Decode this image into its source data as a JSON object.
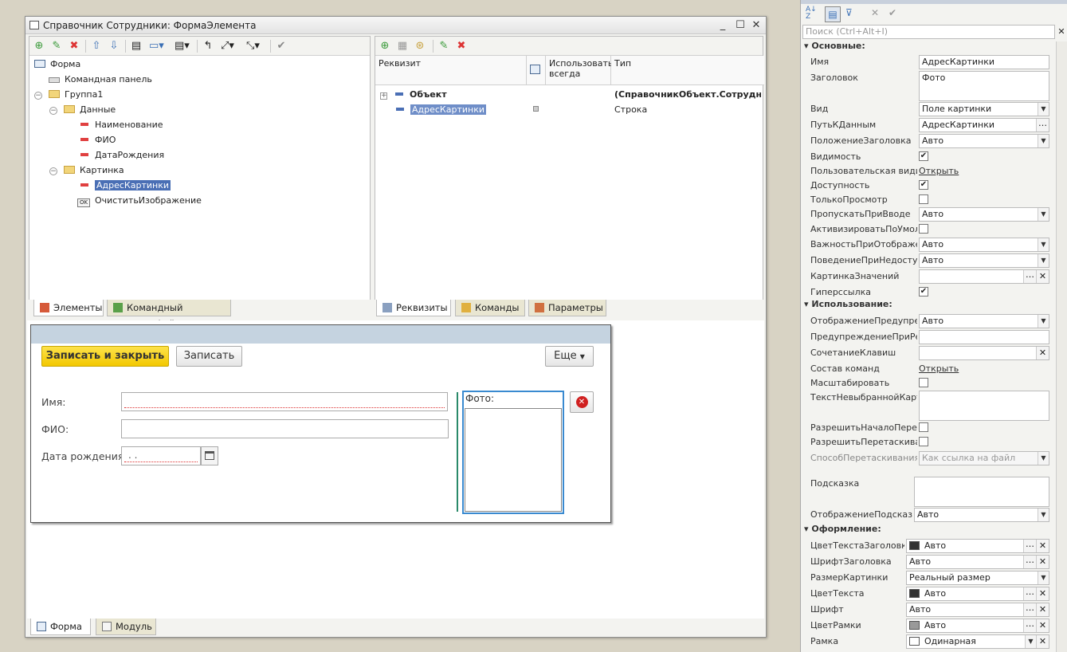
{
  "window": {
    "title": "Справочник Сотрудники: ФормаЭлемента"
  },
  "tree": {
    "items": [
      {
        "label": "Форма",
        "icon": "form-icon"
      },
      {
        "label": "Командная панель",
        "icon": "command-panel-icon"
      },
      {
        "label": "Группа1",
        "icon": "expand-icon"
      },
      {
        "label": "Данные",
        "icon": "folder-icon"
      },
      {
        "label": "Наименование",
        "icon": "field-icon"
      },
      {
        "label": "ФИО",
        "icon": "field-icon"
      },
      {
        "label": "ДатаРождения",
        "icon": "field-icon"
      },
      {
        "label": "Картинка",
        "icon": "folder-icon"
      },
      {
        "label": "АдресКартинки",
        "icon": "field-icon",
        "selected": true
      },
      {
        "label": "ОчиститьИзображение",
        "icon": "ok-button-icon"
      }
    ]
  },
  "left_tabs": [
    "Элементы",
    "Командный интерфейс"
  ],
  "attributes": {
    "columns": [
      "Реквизит",
      "Использовать всегда",
      "Тип"
    ],
    "rows": [
      {
        "name": "Объект",
        "type": "(СправочникОбъект.Сотрудн…"
      },
      {
        "name": "АдресКартинки",
        "type": "Строка"
      }
    ]
  },
  "right_tabs": [
    "Реквизиты",
    "Команды",
    "Параметры"
  ],
  "preview": {
    "save_close": "Записать и закрыть",
    "save": "Записать",
    "more": "Еще",
    "name_label": "Имя:",
    "fio_label": "ФИО:",
    "birth_label": "Дата рождения:",
    "date_placeholder": " .  .",
    "photo_label": "Фото:"
  },
  "bottom_tabs": [
    "Форма",
    "Модуль"
  ],
  "props": {
    "search_placeholder": "Поиск (Ctrl+Alt+I)",
    "sections": [
      "Основные:",
      "Использование:",
      "Оформление:"
    ],
    "rows": [
      {
        "name": "Имя",
        "value": "АдресКартинки"
      },
      {
        "name": "Заголовок",
        "value": "Фото"
      },
      {
        "name": "Вид",
        "value": "Поле картинки"
      },
      {
        "name": "ПутьКДанным",
        "value": "АдресКартинки"
      },
      {
        "name": "ПоложениеЗаголовка",
        "value": "Авто"
      },
      {
        "name": "Видимость",
        "value": "✔"
      },
      {
        "name": "Пользовательская видимость",
        "value": "Открыть"
      },
      {
        "name": "Доступность",
        "value": "✔"
      },
      {
        "name": "ТолькоПросмотр",
        "value": ""
      },
      {
        "name": "ПропускатьПриВводе",
        "value": "Авто"
      },
      {
        "name": "АктивизироватьПоУмолчанию",
        "value": ""
      },
      {
        "name": "ВажностьПриОтображении",
        "value": "Авто"
      },
      {
        "name": "ПоведениеПриНедоступности",
        "value": "Авто"
      },
      {
        "name": "КартинкаЗначений",
        "value": ""
      },
      {
        "name": "Гиперссылка",
        "value": "✔"
      },
      {
        "name": "ОтображениеПредупреждения",
        "value": "Авто"
      },
      {
        "name": "ПредупреждениеПриРедактировании",
        "value": ""
      },
      {
        "name": "СочетаниеКлавиш",
        "value": ""
      },
      {
        "name": "Состав команд",
        "value": "Открыть"
      },
      {
        "name": "Масштабировать",
        "value": ""
      },
      {
        "name": "ТекстНевыбраннойКартинки",
        "value": ""
      },
      {
        "name": "РазрешитьНачалоПеретаскивания",
        "value": ""
      },
      {
        "name": "РазрешитьПеретаскивание",
        "value": ""
      },
      {
        "name": "СпособПеретаскиванияФайлов",
        "value": "Как ссылка на файл"
      },
      {
        "name": "Подсказка",
        "value": ""
      },
      {
        "name": "ОтображениеПодсказки",
        "value": "Авто"
      },
      {
        "name": "ЦветТекстаЗаголовка",
        "value": "Авто"
      },
      {
        "name": "ШрифтЗаголовка",
        "value": "Авто"
      },
      {
        "name": "РазмерКартинки",
        "value": "Реальный размер"
      },
      {
        "name": "ЦветТекста",
        "value": "Авто"
      },
      {
        "name": "Шрифт",
        "value": "Авто"
      },
      {
        "name": "ЦветРамки",
        "value": "Авто"
      },
      {
        "name": "Рамка",
        "value": "Одинарная"
      }
    ]
  }
}
